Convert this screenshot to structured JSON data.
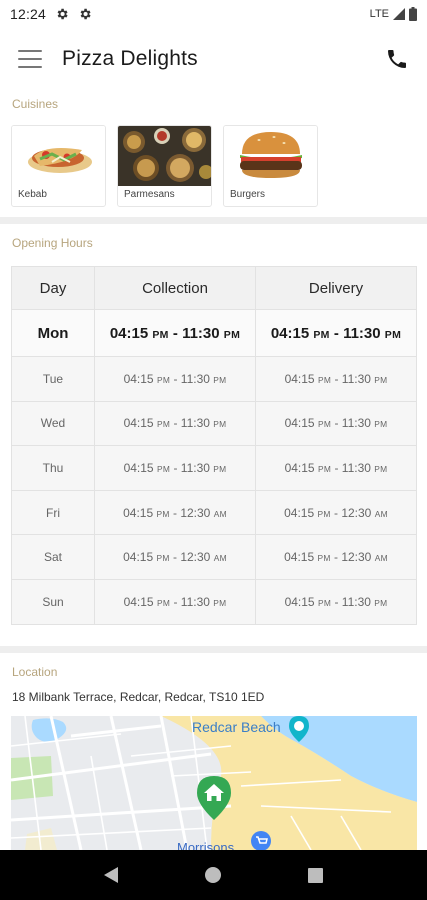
{
  "status_bar": {
    "time": "12:24",
    "network": "LTE",
    "icons": [
      "settings-gear-icon",
      "settings-gear-icon",
      "signal-icon",
      "battery-icon"
    ]
  },
  "app_bar": {
    "title": "Pizza Delights",
    "menu_icon": "hamburger-menu-icon",
    "action_icon": "phone-icon"
  },
  "cuisines": {
    "label": "Cuisines",
    "items": [
      {
        "label": "Kebab",
        "icon": "kebab-image"
      },
      {
        "label": "Parmesans",
        "icon": "parmesans-image"
      },
      {
        "label": "Burgers",
        "icon": "burger-image"
      }
    ]
  },
  "opening_hours": {
    "label": "Opening Hours",
    "headers": [
      "Day",
      "Collection",
      "Delivery"
    ],
    "rows": [
      {
        "day": "Mon",
        "collection": {
          "from": "04:15",
          "from_ampm": "PM",
          "to": "11:30",
          "to_ampm": "PM"
        },
        "delivery": {
          "from": "04:15",
          "from_ampm": "PM",
          "to": "11:30",
          "to_ampm": "PM"
        },
        "today": true
      },
      {
        "day": "Tue",
        "collection": {
          "from": "04:15",
          "from_ampm": "PM",
          "to": "11:30",
          "to_ampm": "PM"
        },
        "delivery": {
          "from": "04:15",
          "from_ampm": "PM",
          "to": "11:30",
          "to_ampm": "PM"
        },
        "today": false
      },
      {
        "day": "Wed",
        "collection": {
          "from": "04:15",
          "from_ampm": "PM",
          "to": "11:30",
          "to_ampm": "PM"
        },
        "delivery": {
          "from": "04:15",
          "from_ampm": "PM",
          "to": "11:30",
          "to_ampm": "PM"
        },
        "today": false
      },
      {
        "day": "Thu",
        "collection": {
          "from": "04:15",
          "from_ampm": "PM",
          "to": "11:30",
          "to_ampm": "PM"
        },
        "delivery": {
          "from": "04:15",
          "from_ampm": "PM",
          "to": "11:30",
          "to_ampm": "PM"
        },
        "today": false
      },
      {
        "day": "Fri",
        "collection": {
          "from": "04:15",
          "from_ampm": "PM",
          "to": "12:30",
          "to_ampm": "AM"
        },
        "delivery": {
          "from": "04:15",
          "from_ampm": "PM",
          "to": "12:30",
          "to_ampm": "AM"
        },
        "today": false
      },
      {
        "day": "Sat",
        "collection": {
          "from": "04:15",
          "from_ampm": "PM",
          "to": "12:30",
          "to_ampm": "AM"
        },
        "delivery": {
          "from": "04:15",
          "from_ampm": "PM",
          "to": "12:30",
          "to_ampm": "AM"
        },
        "today": false
      },
      {
        "day": "Sun",
        "collection": {
          "from": "04:15",
          "from_ampm": "PM",
          "to": "11:30",
          "to_ampm": "PM"
        },
        "delivery": {
          "from": "04:15",
          "from_ampm": "PM",
          "to": "11:30",
          "to_ampm": "PM"
        },
        "today": false
      }
    ]
  },
  "location": {
    "label": "Location",
    "address": "18 Milbank Terrace, Redcar, Redcar, TS10 1ED",
    "map": {
      "labels": [
        "Redcar Beach",
        "Morrisons"
      ],
      "icons": [
        "beach-pin-icon",
        "home-pin-icon",
        "shopping-cart-pin-icon"
      ]
    }
  },
  "nav_bar": {
    "icons": [
      "back-icon",
      "home-icon",
      "recents-icon"
    ]
  },
  "colors": {
    "section_label": "#b7a57e",
    "map_water": "#aadaff",
    "map_sand": "#f9e6a6",
    "pin_green": "#34a853",
    "nav_bar": "#000000"
  }
}
